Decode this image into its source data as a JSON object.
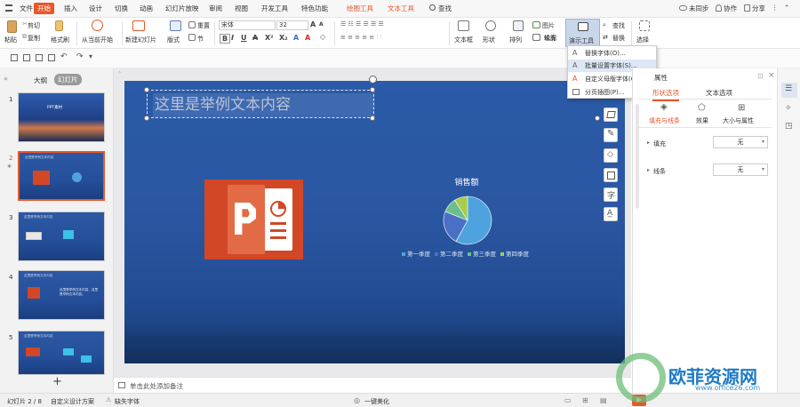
{
  "menubar": {
    "file": "文件",
    "start": "开始",
    "insert": "插入",
    "design": "设计",
    "switch": "切换",
    "animation": "动画",
    "slideshow": "幻灯片放映",
    "review": "审阅",
    "view": "视图",
    "developer": "开发工具",
    "special": "特色功能",
    "draw_tools": "绘图工具",
    "text_tools": "文本工具",
    "search": "查找",
    "unsynced": "未同步",
    "collab": "协作",
    "share": "分享"
  },
  "ribbon": {
    "paste": "粘贴",
    "cut": "剪切",
    "copy": "复制",
    "format_painter": "格式刷",
    "from_current": "从当前开始",
    "new_slide": "新建幻灯片",
    "layout": "版式",
    "section": "节",
    "reset": "重置",
    "font_name": "宋体",
    "font_size": "32",
    "text_box": "文本框",
    "shape": "形状",
    "arrange": "排列",
    "picture": "图片",
    "fill": "填充",
    "outline": "轮廓",
    "present_tools": "演示工具",
    "find": "查找",
    "replace": "替换",
    "select": "选择"
  },
  "dropdown": {
    "items": [
      "替换字体(O)...",
      "批量设置字体(S)...",
      "自定义母版字体(C)...",
      "分页插图(P)..."
    ]
  },
  "leftpanel": {
    "outline_tab": "大纲",
    "slides_tab": "幻灯片",
    "slide_numbers": [
      "1",
      "2",
      "3",
      "4",
      "5"
    ],
    "slide1_title": "PPT素材",
    "slide_header": "这里是举例文本内容",
    "slide4_text": "这里是举例文本内容，这里是举例文本内容。"
  },
  "slide": {
    "title": "这里是举例文本内容"
  },
  "chart_data": {
    "type": "pie",
    "title": "销售额",
    "categories": [
      "第一季度",
      "第二季度",
      "第三季度",
      "第四季度"
    ],
    "values": [
      58,
      23,
      10,
      9
    ],
    "colors": [
      "#4ea3de",
      "#4a70c6",
      "#6cbf8c",
      "#a8cc4e"
    ]
  },
  "rightpanel": {
    "title": "属性",
    "tab_shape": "形状选项",
    "tab_text": "文本选项",
    "sub_fill_line": "填充与线条",
    "sub_effect": "效果",
    "sub_size": "大小与属性",
    "fill_label": "填充",
    "fill_value": "无",
    "line_label": "线条",
    "line_value": "无"
  },
  "notes": {
    "placeholder": "单击此处添加备注"
  },
  "statusbar": {
    "slide_info": "幻灯片 2 / 8",
    "design_scheme": "自定义设计方案",
    "missing_font": "缺失字体",
    "beautify": "一键美化"
  },
  "watermark": {
    "brand": "欧菲资源网",
    "url": "www.office26.com"
  }
}
